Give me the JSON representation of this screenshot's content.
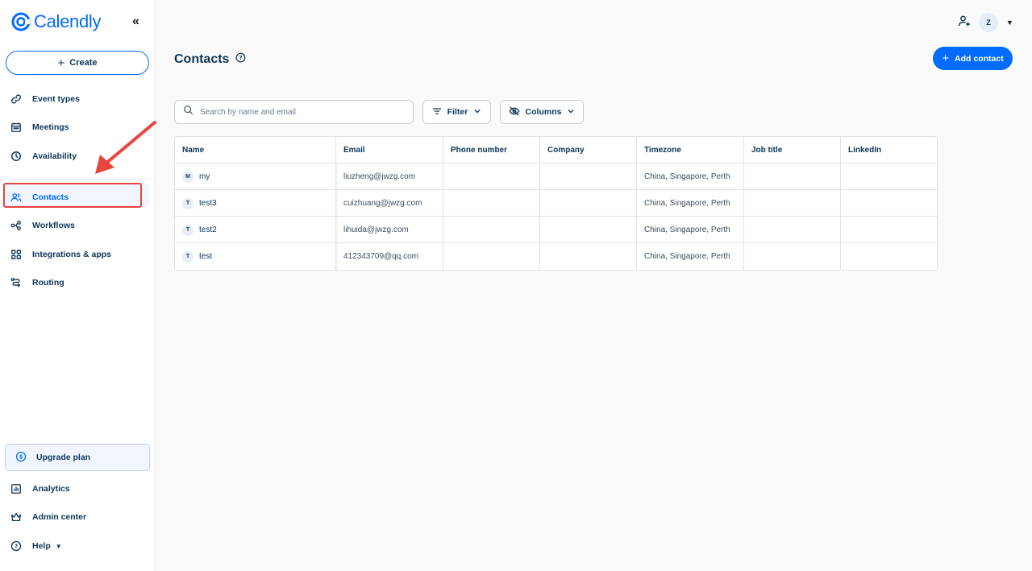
{
  "sidebar": {
    "logo": "Calendly",
    "create_label": "Create",
    "nav": [
      {
        "label": "Event types",
        "icon": "link-icon"
      },
      {
        "label": "Meetings",
        "icon": "calendar-icon"
      },
      {
        "label": "Availability",
        "icon": "clock-icon"
      },
      {
        "label": "Contacts",
        "icon": "people-icon"
      },
      {
        "label": "Workflows",
        "icon": "workflow-icon"
      },
      {
        "label": "Integrations & apps",
        "icon": "grid-icon"
      },
      {
        "label": "Routing",
        "icon": "routing-icon"
      }
    ],
    "upgrade_label": "Upgrade plan",
    "bottom": [
      {
        "label": "Analytics",
        "icon": "chart-icon"
      },
      {
        "label": "Admin center",
        "icon": "crown-icon"
      },
      {
        "label": "Help",
        "icon": "help-icon"
      }
    ]
  },
  "header": {
    "avatar_initial": "Z",
    "page_title": "Contacts",
    "add_contact_label": "Add contact"
  },
  "toolbar": {
    "search_placeholder": "Search by name and email",
    "filter_label": "Filter",
    "columns_label": "Columns"
  },
  "table": {
    "columns": [
      "Name",
      "Email",
      "Phone number",
      "Company",
      "Timezone",
      "Job title",
      "LinkedIn"
    ],
    "rows": [
      {
        "initial": "M",
        "name": "my",
        "email": "liuzheng@jwzg.com",
        "phone": "",
        "company": "",
        "timezone": "China, Singapore, Perth",
        "job": "",
        "linkedin": ""
      },
      {
        "initial": "T",
        "name": "test3",
        "email": "cuizhuang@jwzg.com",
        "phone": "",
        "company": "",
        "timezone": "China, Singapore, Perth",
        "job": "",
        "linkedin": ""
      },
      {
        "initial": "T",
        "name": "test2",
        "email": "lihuida@jwzg.com",
        "phone": "",
        "company": "",
        "timezone": "China, Singapore, Perth",
        "job": "",
        "linkedin": ""
      },
      {
        "initial": "T",
        "name": "test",
        "email": "412343709@qq.com",
        "phone": "",
        "company": "",
        "timezone": "China, Singapore, Perth",
        "job": "",
        "linkedin": ""
      }
    ]
  },
  "colors": {
    "brand": "#006bff",
    "text": "#0b3558",
    "annotation": "#e8453c"
  }
}
